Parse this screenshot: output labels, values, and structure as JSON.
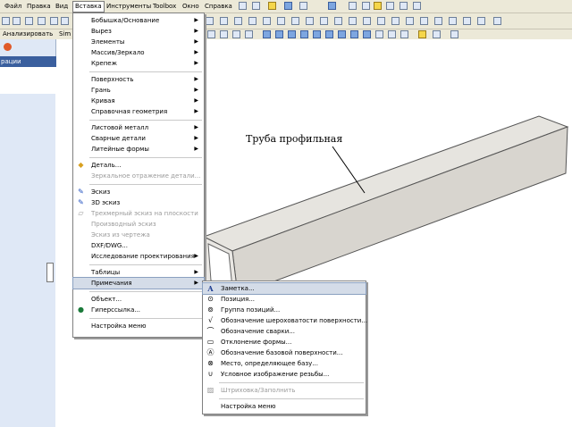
{
  "menubar": {
    "items": [
      "Файл",
      "Правка",
      "Вид",
      "Вставка",
      "Инструменты",
      "Toolbox",
      "Окно",
      "Справка"
    ],
    "active": "Вставка"
  },
  "cmd_tabs": {
    "analyze": "Анализировать",
    "sim": "Sim"
  },
  "left_panel": {
    "header": "рации"
  },
  "viewport": {
    "annotation": "Труба профильная"
  },
  "insert_menu": {
    "items": [
      {
        "label": "Бобышка/Основание",
        "submenu": true
      },
      {
        "label": "Вырез",
        "submenu": true
      },
      {
        "label": "Элементы",
        "submenu": true
      },
      {
        "label": "Массив/Зеркало",
        "submenu": true
      },
      {
        "label": "Крепеж",
        "submenu": true
      },
      {
        "sep": true
      },
      {
        "label": "Поверхность",
        "submenu": true
      },
      {
        "label": "Грань",
        "submenu": true
      },
      {
        "label": "Кривая",
        "submenu": true
      },
      {
        "label": "Справочная геометрия",
        "submenu": true
      },
      {
        "sep": true
      },
      {
        "label": "Листовой металл",
        "submenu": true
      },
      {
        "label": "Сварные детали",
        "submenu": true
      },
      {
        "label": "Литейные формы",
        "submenu": true
      },
      {
        "sep": true
      },
      {
        "label": "Деталь...",
        "icon": "part-icon"
      },
      {
        "label": "Зеркальное отражение детали...",
        "disabled": true
      },
      {
        "sep": true
      },
      {
        "label": "Эскиз",
        "icon": "sketch-icon"
      },
      {
        "label": "3D эскиз",
        "icon": "sketch3d-icon"
      },
      {
        "label": "Трехмерный эскиз на плоскости",
        "disabled": true,
        "icon": "plane-sketch-icon"
      },
      {
        "label": "Производный эскиз",
        "disabled": true
      },
      {
        "label": "Эскиз из чертежа",
        "disabled": true
      },
      {
        "label": "DXF/DWG..."
      },
      {
        "label": "Исследование проектирования",
        "submenu": true
      },
      {
        "sep": true
      },
      {
        "label": "Таблицы",
        "submenu": true
      },
      {
        "label": "Примечания",
        "submenu": true,
        "highlight": true
      },
      {
        "sep": true
      },
      {
        "label": "Объект..."
      },
      {
        "label": "Гиперссылка...",
        "icon": "globe-icon"
      },
      {
        "sep": true
      },
      {
        "label": "Настройка меню"
      }
    ]
  },
  "notes_submenu": {
    "items": [
      {
        "label": "Заметка...",
        "icon": "note-icon",
        "highlight": true
      },
      {
        "label": "Позиция...",
        "icon": "balloon-icon"
      },
      {
        "label": "Группа позиций...",
        "icon": "stacked-balloon-icon"
      },
      {
        "label": "Обозначение шероховатости поверхности...",
        "icon": "surface-finish-icon"
      },
      {
        "label": "Обозначение сварки...",
        "icon": "weld-symbol-icon"
      },
      {
        "label": "Отклонение формы...",
        "icon": "geometric-tolerance-icon"
      },
      {
        "label": "Обозначение базовой поверхности...",
        "icon": "datum-feature-icon"
      },
      {
        "label": "Место, определяющее базу...",
        "icon": "datum-target-icon"
      },
      {
        "label": "Условное изображение резьбы...",
        "icon": "cosmetic-thread-icon"
      },
      {
        "sep": true
      },
      {
        "label": "Штриховка/Заполнить",
        "disabled": true,
        "icon": "hatch-icon"
      },
      {
        "sep": true
      },
      {
        "label": "Настройка меню"
      }
    ]
  },
  "colors": {
    "menubar_bg": "#ece9d8",
    "highlight": "#d4dce8",
    "tube_face": "#d8d5cf"
  }
}
